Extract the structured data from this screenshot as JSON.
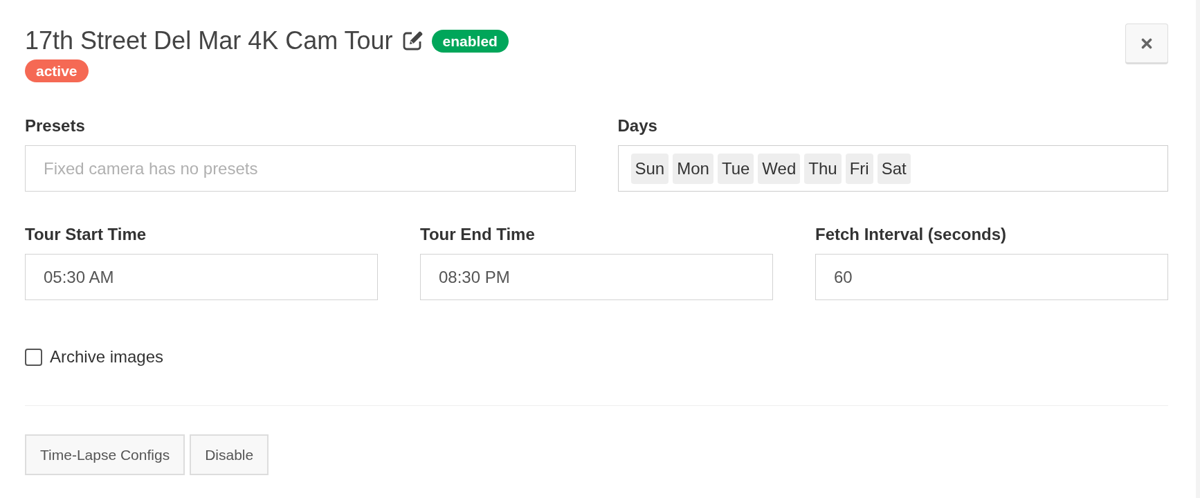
{
  "header": {
    "title": "17th Street Del Mar 4K Cam Tour",
    "badges": [
      {
        "label": "enabled",
        "color": "#00a65a"
      },
      {
        "label": "active",
        "color": "#f56954"
      }
    ]
  },
  "field_rows": [
    [
      {
        "kind": "text",
        "label": "Presets",
        "placeholder": "Fixed camera has no presets"
      },
      {
        "kind": "tags",
        "label": "Days",
        "tags": [
          "Sun",
          "Mon",
          "Tue",
          "Wed",
          "Thu",
          "Fri",
          "Sat"
        ]
      }
    ],
    [
      {
        "kind": "text",
        "label": "Tour Start Time",
        "value": "05:30 AM"
      },
      {
        "kind": "text",
        "label": "Tour End Time",
        "value": "08:30 PM"
      },
      {
        "kind": "text",
        "label": "Fetch Interval (seconds)",
        "value": "60"
      }
    ]
  ],
  "archive_images": {
    "label": "Archive images",
    "checked": false
  },
  "buttons": [
    "Time-Lapse Configs",
    "Disable"
  ]
}
